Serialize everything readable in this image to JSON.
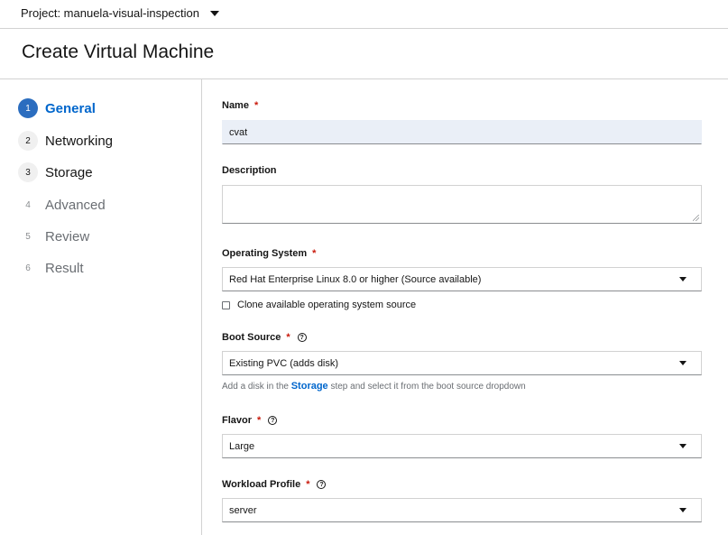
{
  "project": {
    "label": "Project: manuela-visual-inspection"
  },
  "page": {
    "title": "Create Virtual Machine"
  },
  "steps": [
    {
      "num": "1",
      "label": "General"
    },
    {
      "num": "2",
      "label": "Networking"
    },
    {
      "num": "3",
      "label": "Storage"
    },
    {
      "num": "4",
      "label": "Advanced"
    },
    {
      "num": "5",
      "label": "Review"
    },
    {
      "num": "6",
      "label": "Result"
    }
  ],
  "form": {
    "required_marker": "*",
    "help_glyph": "?",
    "name": {
      "label": "Name",
      "value": "cvat"
    },
    "description": {
      "label": "Description",
      "value": ""
    },
    "os": {
      "label": "Operating System",
      "value": "Red Hat Enterprise Linux 8.0 or higher (Source available)"
    },
    "clone": {
      "label": "Clone available operating system source",
      "checked": false
    },
    "boot": {
      "label": "Boot Source",
      "value": "Existing PVC (adds disk)",
      "hint_before": "Add a disk in the ",
      "hint_link": "Storage",
      "hint_after": " step and select it from the boot source dropdown"
    },
    "flavor": {
      "label": "Flavor",
      "value": "Large"
    },
    "workload": {
      "label": "Workload Profile",
      "value": "server"
    }
  }
}
